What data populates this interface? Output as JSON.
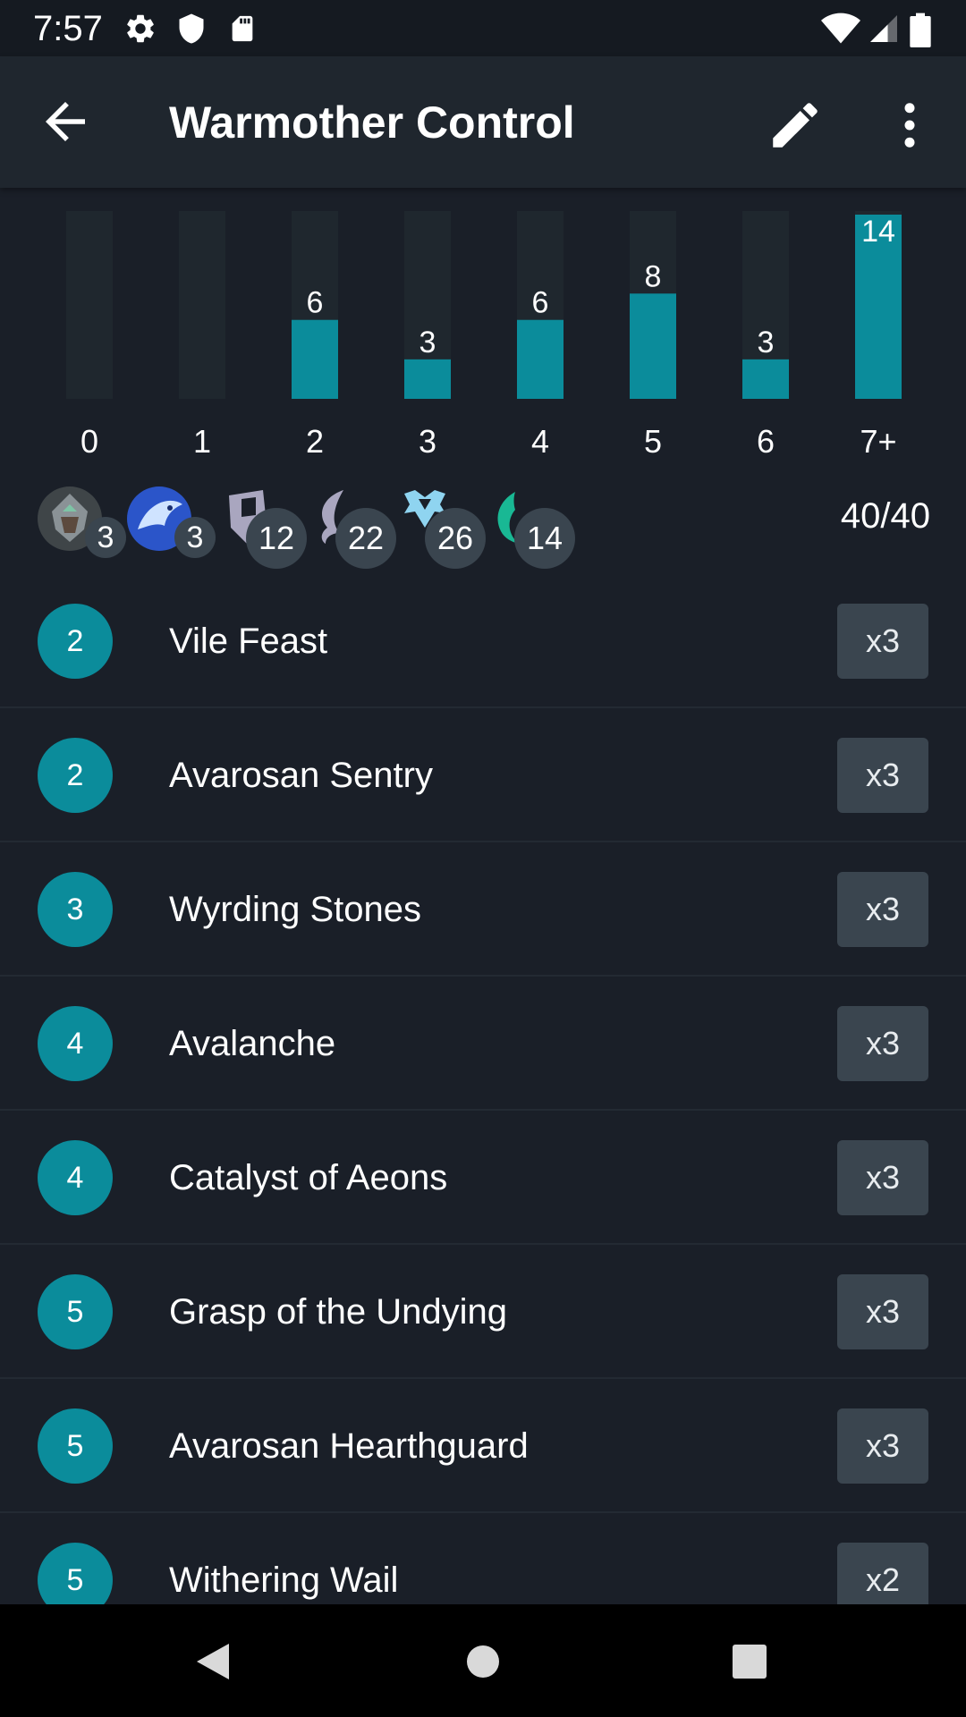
{
  "status_bar": {
    "time": "7:57",
    "icons_left": [
      "gear-icon",
      "shield-icon",
      "sd-card-icon"
    ],
    "icons_right": [
      "wifi-icon",
      "signal-icon",
      "battery-icon"
    ]
  },
  "app_bar": {
    "title": "Warmother Control",
    "back_icon": "arrow-back-icon",
    "edit_icon": "pencil-icon",
    "more_icon": "more-vert-icon"
  },
  "chart_data": {
    "type": "bar",
    "categories": [
      "0",
      "1",
      "2",
      "3",
      "4",
      "5",
      "6",
      "7+"
    ],
    "values": [
      0,
      0,
      6,
      3,
      6,
      8,
      3,
      14
    ],
    "ylim": [
      0,
      14
    ],
    "bar_color": "#0b8c9b",
    "track_color": "#1f272e"
  },
  "deck": {
    "champions": [
      {
        "icon": "champion-portrait-armored-warrior",
        "count": "3"
      },
      {
        "icon": "champion-portrait-blue-eagle",
        "count": "3"
      }
    ],
    "types": [
      {
        "icon": "follower-shield-icon",
        "count": "12"
      },
      {
        "icon": "spell-swirl-icon",
        "count": "22"
      }
    ],
    "regions": [
      {
        "icon": "freljord-region-icon",
        "count": "26"
      },
      {
        "icon": "shadow-isles-region-icon",
        "count": "14"
      }
    ],
    "total": "40/40"
  },
  "cards": [
    {
      "cost": "2",
      "name": "Vile Feast",
      "count": "x3"
    },
    {
      "cost": "2",
      "name": "Avarosan Sentry",
      "count": "x3"
    },
    {
      "cost": "3",
      "name": "Wyrding Stones",
      "count": "x3"
    },
    {
      "cost": "4",
      "name": "Avalanche",
      "count": "x3"
    },
    {
      "cost": "4",
      "name": "Catalyst of Aeons",
      "count": "x3"
    },
    {
      "cost": "5",
      "name": "Grasp of the Undying",
      "count": "x3"
    },
    {
      "cost": "5",
      "name": "Avarosan Hearthguard",
      "count": "x3"
    },
    {
      "cost": "5",
      "name": "Withering Wail",
      "count": "x2"
    }
  ],
  "nav_bar": {
    "back": "nav-back-icon",
    "home": "nav-home-icon",
    "recents": "nav-recents-icon"
  },
  "colors": {
    "background": "#1a1f28",
    "app_bar": "#1f262e",
    "accent": "#0b8c9b",
    "chip": "#3a454f"
  }
}
